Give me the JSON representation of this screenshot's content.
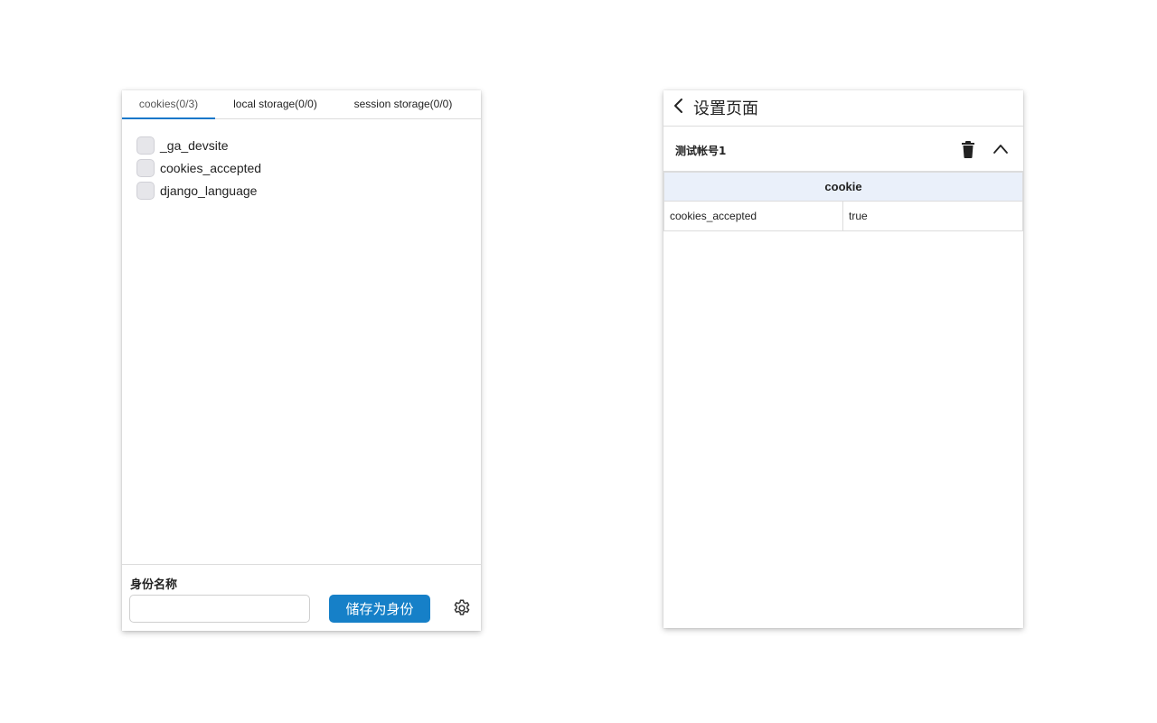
{
  "left_panel": {
    "tabs": [
      {
        "label": "cookies(0/3)",
        "active": true
      },
      {
        "label": "local storage(0/0)",
        "active": false
      },
      {
        "label": "session storage(0/0)",
        "active": false
      }
    ],
    "cookies": [
      {
        "name": "_ga_devsite",
        "checked": false
      },
      {
        "name": "cookies_accepted",
        "checked": false
      },
      {
        "name": "django_language",
        "checked": false
      }
    ],
    "footer": {
      "identity_label": "身份名称",
      "identity_value": "",
      "save_label": "储存为身份"
    }
  },
  "right_panel": {
    "title": "设置页面",
    "account": {
      "name": "测试帐号1",
      "table_header": "cookie",
      "rows": [
        {
          "key": "cookies_accepted",
          "value": "true"
        }
      ]
    }
  },
  "colors": {
    "accent": "#1680c8",
    "header_bg": "#eaf0fa",
    "checkbox_bg": "#e6e6ea"
  }
}
